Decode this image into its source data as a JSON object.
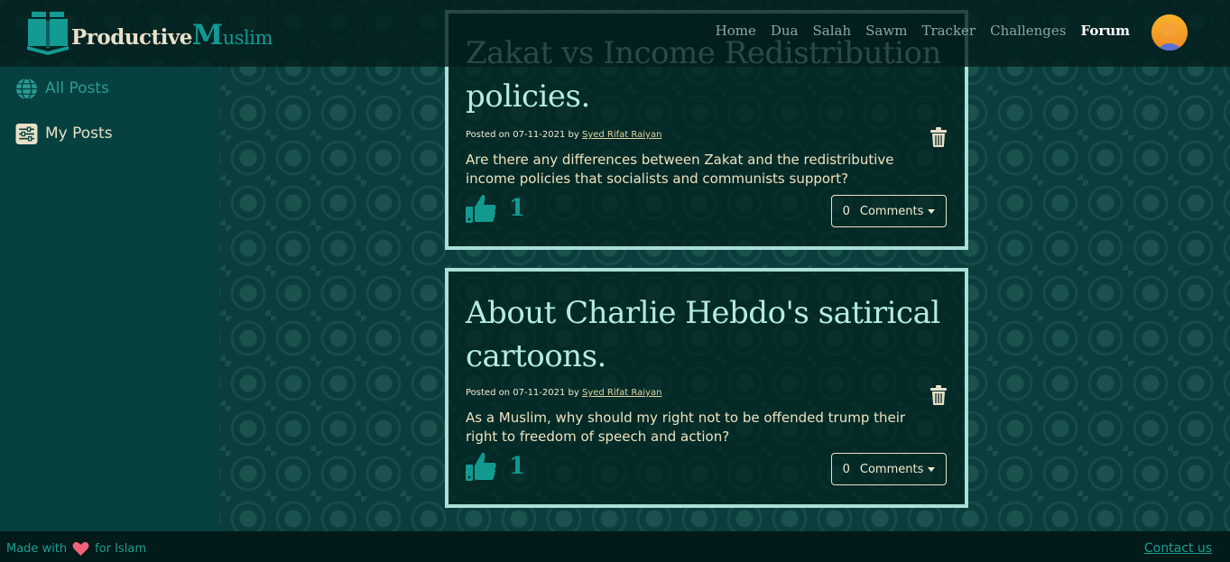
{
  "brand": {
    "part1": "Productive",
    "part2_initial": "M",
    "part2_rest": "uslim"
  },
  "nav": {
    "items": [
      "Home",
      "Dua",
      "Salah",
      "Sawm",
      "Tracker",
      "Challenges",
      "Forum"
    ],
    "active": "Forum"
  },
  "sidebar": {
    "items": [
      {
        "label": "All Posts",
        "icon": "globe-icon"
      },
      {
        "label": "My Posts",
        "icon": "sliders-icon"
      }
    ]
  },
  "posts": [
    {
      "title": "Zakat vs Income Redistribution policies.",
      "meta_prefix": "Posted on 07-11-2021 by",
      "author": "Syed Rifat Raiyan",
      "body": "Are there any differences between Zakat and the redistributive income policies that socialists and communists support?",
      "likes": "1",
      "comments_count": "0",
      "comments_label": "Comments"
    },
    {
      "title": "About Charlie Hebdo's satirical cartoons.",
      "meta_prefix": "Posted on 07-11-2021 by",
      "author": "Syed Rifat Raiyan",
      "body": "As a Muslim, why should my right not to be offended trump their right to freedom of speech and action?",
      "likes": "1",
      "comments_count": "0",
      "comments_label": "Comments"
    }
  ],
  "footer": {
    "made_with": "Made with",
    "for_islam": "for Islam",
    "contact": "Contact us"
  },
  "colors": {
    "accent": "#129a93",
    "card_border": "#a7e0d6",
    "title": "#b4ecde"
  }
}
